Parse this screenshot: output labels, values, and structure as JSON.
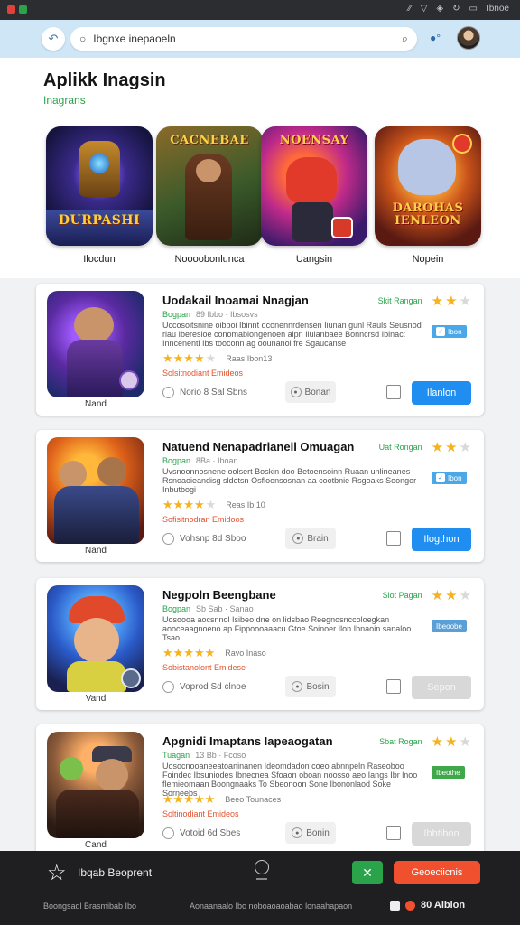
{
  "header": {
    "search_value": "Ibgnxe inepaoeln",
    "back_icon": "back-arrow-icon",
    "search_icon": "magnifier-icon",
    "clear_icon": "clear-icon"
  },
  "page": {
    "title": "Aplikk Inagsin",
    "subtitle": "Inagrans"
  },
  "featured": [
    {
      "banner": "DURPASHI",
      "caption": "Ilocdun"
    },
    {
      "banner": "CACNEBAE",
      "caption": "Noooobonlunca"
    },
    {
      "banner": "NOENSAY",
      "caption": "Uangsin"
    },
    {
      "banner": "DAROHAS IENLEON",
      "caption": "Nopein"
    }
  ],
  "apps": [
    {
      "title": "Uodakail Inoamai Nnagjan",
      "meta_green": "Bogpan",
      "meta_grey": "89 Ibbo · Ibsosvs",
      "rating_label": "Skit Rangan",
      "rating_stars": 2.5,
      "tag": "Ibon",
      "tag_color": "#4aa8e8",
      "description": "Uccosoitsnine oibboi Ibinnt dconennrdensen Iiunan gunl Rauls Seusnod riau Iberesioe conomabiongenoen aipn Iluianbaee Bonncrsd Ibinac: Inncenenti Ibs tooconn ag oounanoi fre Sgaucanse",
      "stars": 4,
      "reviews": "Raas Ibon13",
      "warning": "Solsitnodiant Emideos",
      "option": "Norio 8 Sal Sbns",
      "chip": "Bonan",
      "button": "Ilanlon",
      "button_active": true,
      "under": "Nand"
    },
    {
      "title": "Natuend Nenapadrianeil Omuagan",
      "meta_green": "Bogpan",
      "meta_grey": "8Ba · Iboan",
      "rating_label": "Uat Rongan",
      "rating_stars": 2.5,
      "tag": "Ibon",
      "tag_color": "#4aa8e8",
      "description": "Uvsnoonnosnene oolsert Boskin doo Betoensoinn Ruaan unlineanes Rsnoaoieandisg sldetsn Osfloonsosnan aa cootbnie Rsgoaks Soongor Inbutbogi",
      "stars": 4,
      "reviews": "Reas Ib 10",
      "warning": "Sofisitnodran Emidoos",
      "option": "Vohsnp 8d Sboo",
      "chip": "Brain",
      "button": "Ilogthon",
      "button_active": true,
      "under": "Nand"
    },
    {
      "title": "Negpoln Beengbane",
      "meta_green": "Bogpan",
      "meta_grey": "Sb Sab · Sanao",
      "rating_label": "Slot Pagan",
      "rating_stars": 2.5,
      "tag": "Ibeoobe",
      "tag_color": "#5a9fd6",
      "description": "Uosoooa aocsnnol Isibeo dne on lidsbao Reegnosnccoloegkan aooceaagnoeno ap Fippoooaaacu Gtoe Soinoer Ilon Ibnaoin sanaloo Tsao",
      "stars": 5,
      "reviews": "Ravo Inaso",
      "warning": "Sobistanolont Emidese",
      "option": "Voprod Sd clnoe",
      "chip": "Bosin",
      "button": "Sepon",
      "button_active": false,
      "under": "Vand"
    },
    {
      "title": "Apgnidi Imaptans Iapeaogatan",
      "meta_green": "Tuagan",
      "meta_grey": "13 Bb · Fcoso",
      "rating_label": "Sbat Rogan",
      "rating_stars": 2.5,
      "tag": "Ibeothe",
      "tag_color": "#3ea84a",
      "description": "Uosocnooaneeatoaninanen Ideomdadon coeo abnnpeln Raseoboo Foindec Ibsuniodes Ibnecnea Sfoaon oboan noosso aeo Iangs Ibr lnoo flemieomaan Boongnaaks To Sbeonoon Sone Ibononlaod Soke Sorneebs",
      "stars": 5,
      "reviews": "Beeo Tounaces",
      "warning": "Soltinodiant Emideos",
      "option": "Votoid 6d Sbes",
      "chip": "Bonin",
      "button": "Ibbtibon",
      "button_active": false,
      "under": "Cand"
    }
  ],
  "bottom": {
    "label": "Ibqab Beoprent",
    "cta": "Geoeciicnis",
    "footer_left": "Boongsadl Brasmibab Ibo",
    "footer_center": "Aonaanaalo Ibo noboaoaoabao lonaahapaon",
    "footer_right": "80 Alblon"
  },
  "colors": {
    "accent_blue": "#1f8ef0",
    "accent_green": "#2aa34a",
    "accent_orange": "#f0502e",
    "star": "#f5b21c"
  }
}
